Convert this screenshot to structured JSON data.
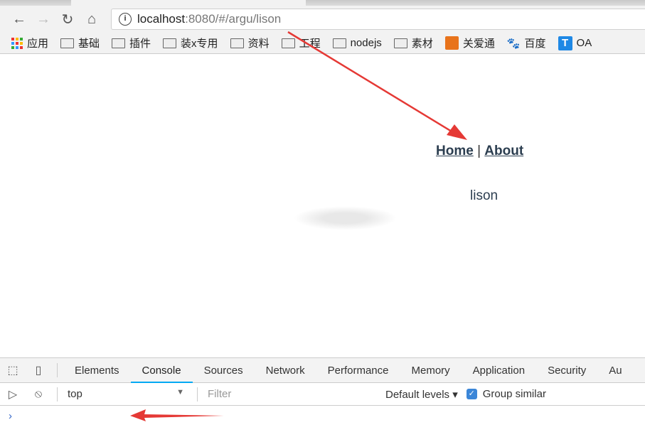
{
  "browser": {
    "url_host": "localhost",
    "url_rest": ":8080/#/argu/lison",
    "bookmarks": [
      "应用",
      "基础",
      "插件",
      "装x专用",
      "资料",
      "工程",
      "nodejs",
      "素材",
      "关爱通",
      "百度",
      "OA"
    ]
  },
  "page": {
    "nav": {
      "home": "Home",
      "separator": "|",
      "about": "About"
    },
    "param_text": "lison"
  },
  "devtools": {
    "tabs": [
      "Elements",
      "Console",
      "Sources",
      "Network",
      "Performance",
      "Memory",
      "Application",
      "Security",
      "Au"
    ],
    "active_tab": "Console",
    "context": "top",
    "filter_placeholder": "Filter",
    "levels": "Default levels ▾",
    "group_similar": "Group similar",
    "group_similar_checked": true,
    "prompt": "›"
  },
  "colors": {
    "annotation_arrow": "#e53935",
    "active_tab_underline": "#03a9f4"
  }
}
